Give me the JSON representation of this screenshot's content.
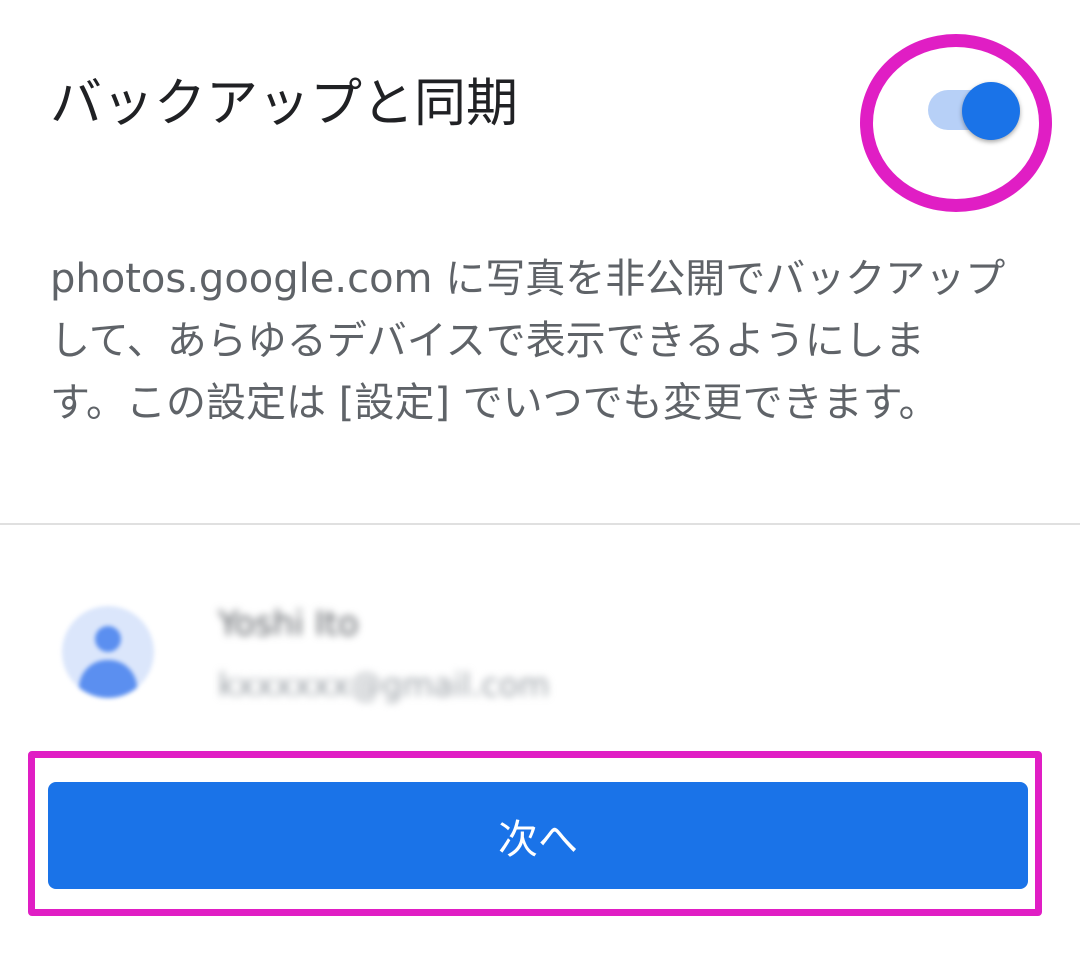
{
  "header": {
    "title": "バックアップと同期",
    "toggle": {
      "state": "on",
      "accent_color": "#1a73e8",
      "track_color": "#b7d0f7"
    }
  },
  "description": {
    "lines": [
      "photos.google.com に写真を非公開でバックアップ",
      "して、あらゆるデバイスで表示できるようにしま",
      "す。この設定は [設定] でいつでも変更できます。"
    ]
  },
  "account": {
    "avatar_icon": "person-icon",
    "name": "Yoshi Ito",
    "email": "kxxxxxx@gmail.com"
  },
  "footer": {
    "next_label": "次へ",
    "button_color": "#1a73e8"
  },
  "annotations": {
    "highlight_color": "#e01ec4"
  }
}
